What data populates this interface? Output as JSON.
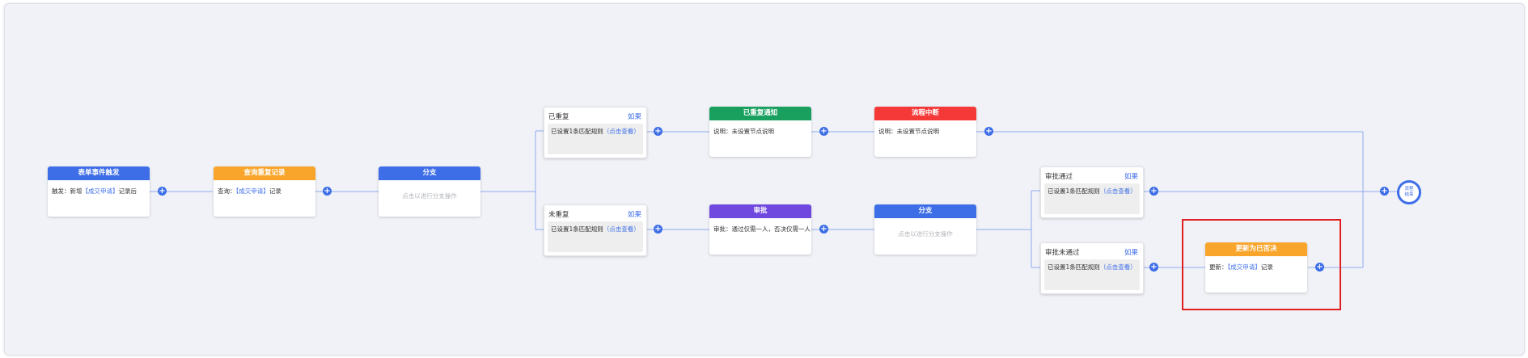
{
  "colors": {
    "blue": "#3d6ee8",
    "orange": "#f9a52b",
    "green": "#19a05f",
    "red": "#f53838",
    "purple": "#7048e0",
    "line": "#8fa9ef",
    "highlight": "#e02020"
  },
  "nodes": {
    "trigger": {
      "title": "表单事件触发",
      "prefix": "触发：",
      "pre": "新增",
      "link": "【成交申请】",
      "post": "记录后"
    },
    "query": {
      "title": "查询重复记录",
      "prefix": "查询：",
      "link": "【成交申请】",
      "post": "记录"
    },
    "branch1": {
      "title": "分支",
      "hint": "点击以进行分支操作"
    },
    "cond_dup": {
      "title": "已重复",
      "if_label": "如果",
      "text": "已设置1条匹配规则",
      "link": "（点击查看）"
    },
    "cond_nodup": {
      "title": "未重复",
      "if_label": "如果",
      "text": "已设置1条匹配规则",
      "link": "（点击查看）"
    },
    "notify": {
      "title": "已重复通知",
      "prefix": "说明：",
      "text": "未设置节点说明"
    },
    "abort": {
      "title": "流程中断",
      "prefix": "说明：",
      "text": "未设置节点说明"
    },
    "approve": {
      "title": "审批",
      "prefix": "审批：",
      "text": "通过仅需一人，否决仅需一人"
    },
    "branch2": {
      "title": "分支",
      "hint": "点击以进行分支操作"
    },
    "cond_pass": {
      "title": "审批通过",
      "if_label": "如果",
      "text": "已设置1条匹配规则",
      "link": "（点击查看）"
    },
    "cond_fail": {
      "title": "审批未通过",
      "if_label": "如果",
      "text": "已设置1条匹配规则",
      "link": "（点击查看）"
    },
    "update": {
      "title": "更新为已否决",
      "prefix": "更新：",
      "link": "【成交申请】",
      "post": "记录"
    },
    "end": {
      "label": "流程结束"
    }
  },
  "icons": {
    "add": "plus-circle-icon",
    "plus_glyph": "+"
  }
}
